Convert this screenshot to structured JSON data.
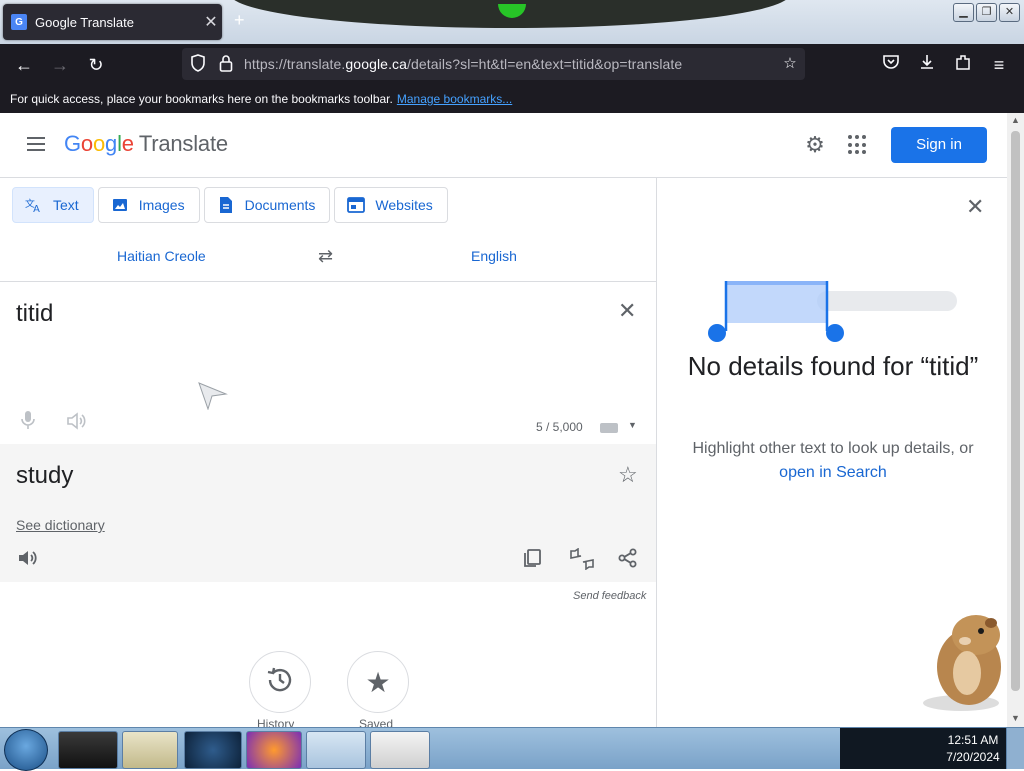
{
  "browser": {
    "tab_title": "Google Translate",
    "tab_favicon": "G",
    "url_prefix": "https://translate.",
    "url_domain": "google.ca",
    "url_suffix": "/details?sl=ht&tl=en&text=titid&op=translate",
    "bookmarks_text": "For quick access, place your bookmarks here on the bookmarks toolbar.",
    "bookmarks_link": "Manage bookmarks..."
  },
  "header": {
    "logo_letters": [
      "G",
      "o",
      "o",
      "g",
      "l",
      "e"
    ],
    "logo_product": "Translate",
    "signin_label": "Sign in"
  },
  "modes": [
    {
      "label": "Text",
      "icon": "translate-icon",
      "active": true
    },
    {
      "label": "Images",
      "icon": "image-icon",
      "active": false
    },
    {
      "label": "Documents",
      "icon": "document-icon",
      "active": false
    },
    {
      "label": "Websites",
      "icon": "website-icon",
      "active": false
    }
  ],
  "languages": {
    "source": "Haitian Creole",
    "target": "English"
  },
  "source": {
    "text": "titid",
    "char_count": "5 / 5,000"
  },
  "target": {
    "text": "study",
    "dictionary_link": "See dictionary",
    "feedback": "Send feedback"
  },
  "details_panel": {
    "title": "No details found for “titid”",
    "hint_text": "Highlight other text to look up details, or",
    "hint_link": "open in Search"
  },
  "bottom_buttons": [
    {
      "label": "History",
      "icon": "history-icon"
    },
    {
      "label": "Saved",
      "icon": "star-icon"
    }
  ],
  "taskbar": {
    "time": "12:51 AM",
    "date": "7/20/2024"
  },
  "colors": {
    "accent": "#1a73e8",
    "link": "#1967d2",
    "browser_dark": "#1c1b22"
  }
}
